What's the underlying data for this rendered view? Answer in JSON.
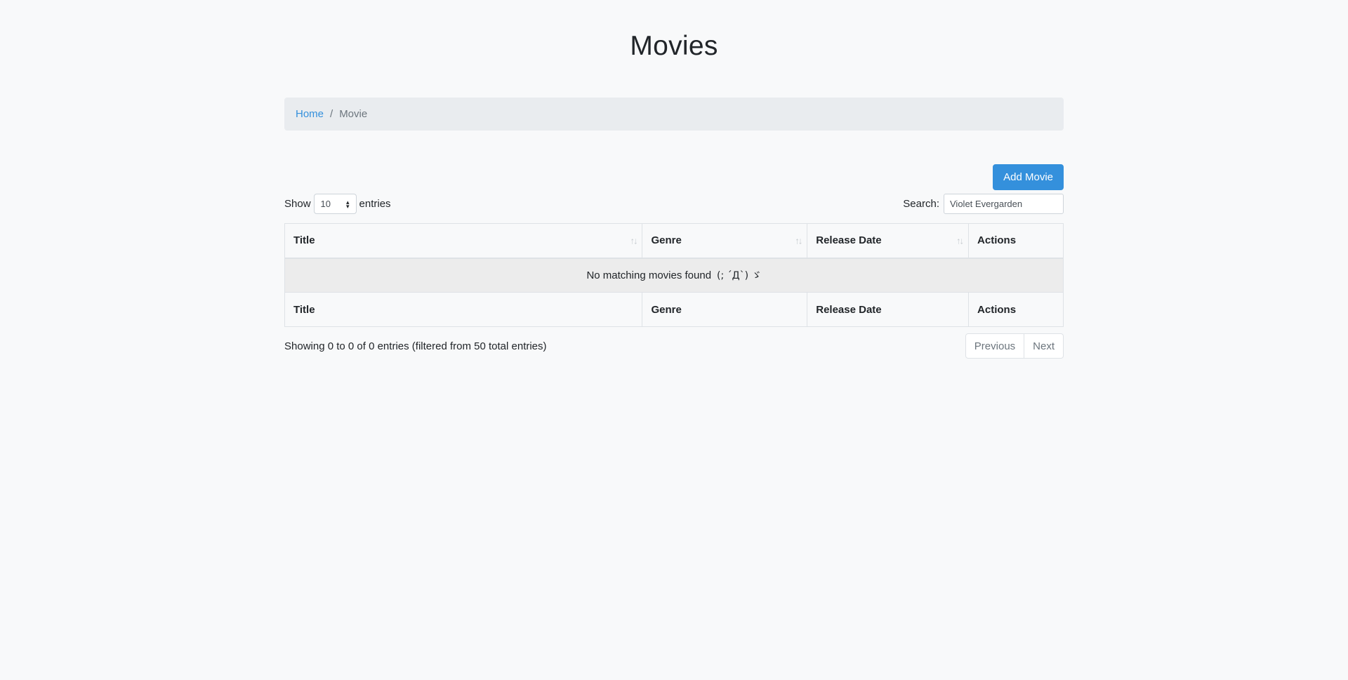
{
  "page": {
    "title": "Movies"
  },
  "breadcrumb": {
    "home": "Home",
    "separator": "/",
    "current": "Movie"
  },
  "toolbar": {
    "add_label": "Add Movie"
  },
  "length": {
    "prefix": "Show",
    "value": "10",
    "suffix": "entries"
  },
  "search": {
    "label": "Search:",
    "value": "Violet Evergarden"
  },
  "table": {
    "columns": [
      "Title",
      "Genre",
      "Release Date",
      "Actions"
    ],
    "empty_message": "No matching movies found",
    "empty_face": "(; ´Д`) ゞ"
  },
  "footer": {
    "info": "Showing 0 to 0 of 0 entries (filtered from 50 total entries)"
  },
  "pagination": {
    "previous": "Previous",
    "next": "Next"
  },
  "colors": {
    "primary": "#3490dc",
    "background": "#f8f9fa",
    "breadcrumb_bg": "#e9ecef"
  }
}
